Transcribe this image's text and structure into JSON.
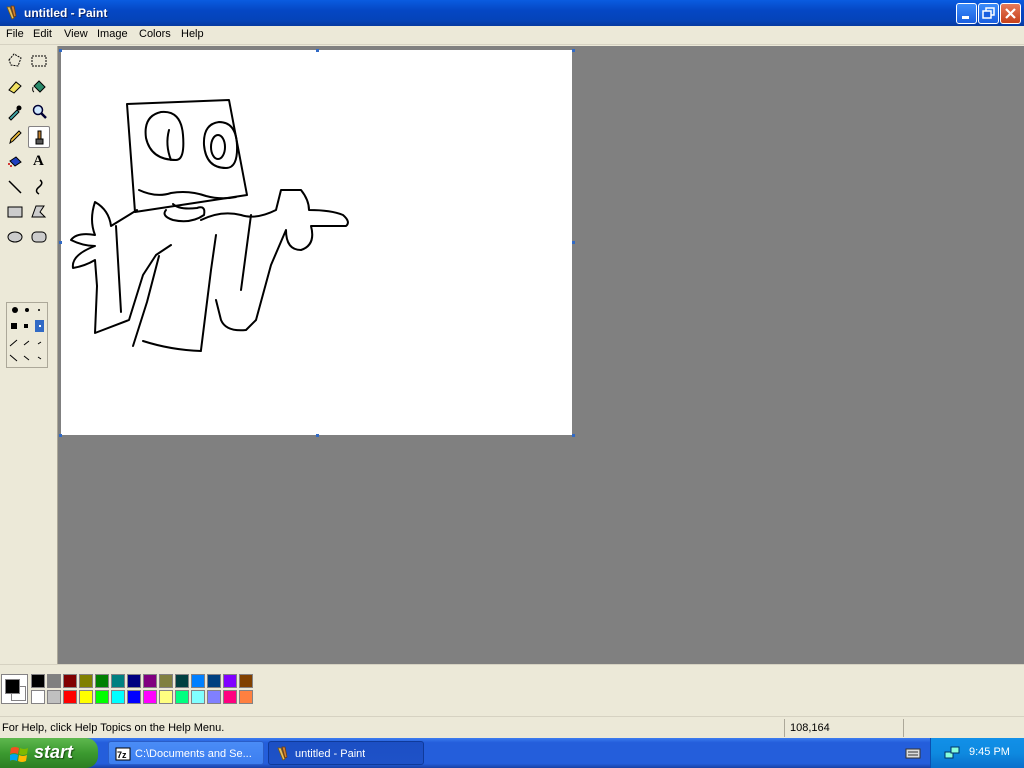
{
  "window": {
    "title": "untitled - Paint"
  },
  "menu": [
    "File",
    "Edit",
    "View",
    "Image",
    "Colors",
    "Help"
  ],
  "tools": [
    "free-form-select",
    "select",
    "eraser",
    "fill-with-color",
    "pick-color",
    "magnifier",
    "pencil",
    "brush",
    "airbrush",
    "text",
    "line",
    "curve",
    "rectangle",
    "polygon",
    "ellipse",
    "rounded-rectangle"
  ],
  "active_tool": "brush",
  "text_tool_label": "A",
  "palette": {
    "foreground": "#000000",
    "background": "#ffffff",
    "colors": [
      "#000000",
      "#808080",
      "#800000",
      "#808000",
      "#008000",
      "#008080",
      "#000080",
      "#800080",
      "#808040",
      "#004040",
      "#0080ff",
      "#004080",
      "#8000ff",
      "#804000",
      "#ffffff",
      "#c0c0c0",
      "#ff0000",
      "#ffff00",
      "#00ff00",
      "#00ffff",
      "#0000ff",
      "#ff00ff",
      "#ffff80",
      "#00ff80",
      "#80ffff",
      "#8080ff",
      "#ff0080",
      "#ff8040"
    ]
  },
  "status": {
    "help": "For Help, click Help Topics on the Help Menu.",
    "coords": "108,164"
  },
  "taskbar": {
    "start_label": "start",
    "tasks": [
      "C:\\Documents and Se...",
      "untitled - Paint"
    ],
    "clock": "9:45 PM"
  }
}
